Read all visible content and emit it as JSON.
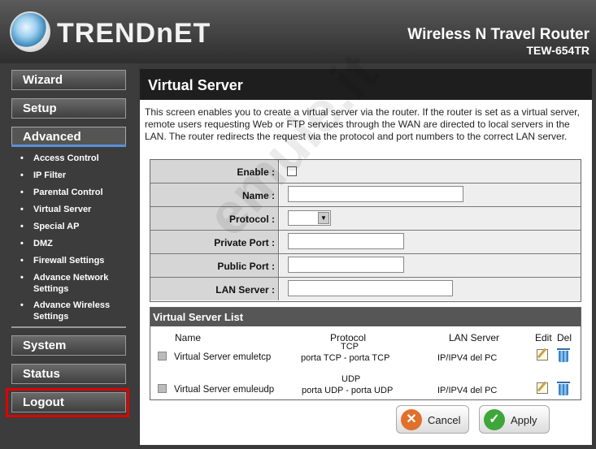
{
  "brand": {
    "name": "TRENDnET",
    "product": "Wireless N Travel Router",
    "model": "TEW-654TR"
  },
  "sidebar": {
    "wizard": "Wizard",
    "setup": "Setup",
    "advanced": "Advanced",
    "submenu": [
      "Access Control",
      "IP Filter",
      "Parental Control",
      "Virtual Server",
      "Special AP",
      "DMZ",
      "Firewall Settings",
      "Advance Network Settings",
      "Advance Wireless Settings"
    ],
    "system": "System",
    "status": "Status",
    "logout": "Logout"
  },
  "main": {
    "title": "Virtual Server",
    "description": "This screen enables you to create a virtual server via the router. If the router is set as a virtual server, remote users requesting Web or FTP services through the WAN are directed to local servers in the LAN. The router redirects the request via the protocol and port numbers to the correct LAN server.",
    "form": {
      "enable_label": "Enable :",
      "name_label": "Name :",
      "protocol_label": "Protocol :",
      "private_port_label": "Private Port :",
      "public_port_label": "Public Port :",
      "lan_server_label": "LAN Server :",
      "name_value": "",
      "private_port_value": "",
      "public_port_value": "",
      "lan_server_value": ""
    },
    "list": {
      "title": "Virtual Server List",
      "headers": {
        "name": "Name",
        "protocol": "Protocol",
        "lan_server": "LAN Server",
        "edit": "Edit",
        "del": "Del"
      },
      "rows": [
        {
          "name": "Virtual Server emuletcp",
          "protocol_type": "TCP",
          "protocol_ports": "porta TCP - porta TCP",
          "lan_server": "IP/IPV4 del PC"
        },
        {
          "name": "Virtual Server emuleudp",
          "protocol_type": "UDP",
          "protocol_ports": "porta UDP - porta UDP",
          "lan_server": "IP/IPV4 del PC"
        }
      ]
    },
    "buttons": {
      "cancel": "Cancel",
      "apply": "Apply"
    }
  },
  "watermark": "emule.it",
  "colors": {
    "header_dark": "#2e2e2e",
    "logout_highlight": "#e00000",
    "advanced_accent": "#5b8fd6",
    "cancel_icon": "#e0702a",
    "apply_icon": "#3fa63a"
  }
}
